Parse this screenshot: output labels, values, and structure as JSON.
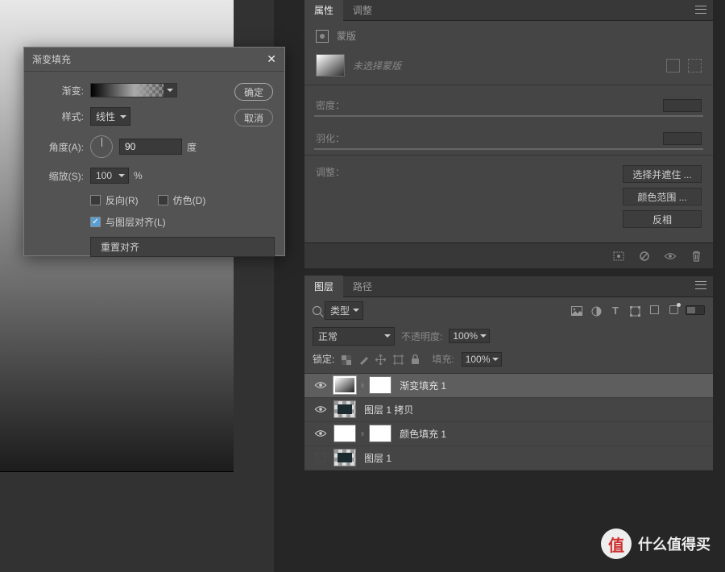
{
  "dialog": {
    "title": "渐变填充",
    "gradient_label": "渐变:",
    "style_label": "样式:",
    "style_value": "线性",
    "angle_label": "角度(A):",
    "angle_value": "90",
    "angle_unit": "度",
    "scale_label": "缩放(S):",
    "scale_value": "100",
    "scale_unit": "%",
    "reverse_label": "反向(R)",
    "reverse_checked": false,
    "dither_label": "仿色(D)",
    "dither_checked": false,
    "align_label": "与图层对齐(L)",
    "align_checked": true,
    "reset_label": "重置对齐",
    "ok_label": "确定",
    "cancel_label": "取消"
  },
  "properties_panel": {
    "tabs": [
      "属性",
      "调整"
    ],
    "active_tab": 0,
    "mask_label": "蒙版",
    "unselected_mask": "未选择蒙版",
    "density_label": "密度：",
    "feather_label": "羽化：",
    "adjust_label": "调整：",
    "buttons": [
      "选择并遮住 ...",
      "颜色范围 ...",
      "反相"
    ]
  },
  "layers_panel": {
    "tabs": [
      "图层",
      "路径"
    ],
    "active_tab": 0,
    "filter_label": "类型",
    "blend_mode": "正常",
    "opacity_label": "不透明度:",
    "opacity_value": "100%",
    "lock_label": "锁定:",
    "fill_label": "填充:",
    "fill_value": "100%",
    "layers": [
      {
        "name": "渐变填充 1",
        "visible": true,
        "selected": true,
        "type": "gradient-fill"
      },
      {
        "name": "图层 1 拷贝",
        "visible": true,
        "selected": false,
        "type": "bitmap"
      },
      {
        "name": "颜色填充 1",
        "visible": true,
        "selected": false,
        "type": "color-fill"
      },
      {
        "name": "图层 1",
        "visible": false,
        "selected": false,
        "type": "bitmap"
      }
    ]
  },
  "watermark": {
    "badge": "值",
    "text": "什么值得买"
  }
}
